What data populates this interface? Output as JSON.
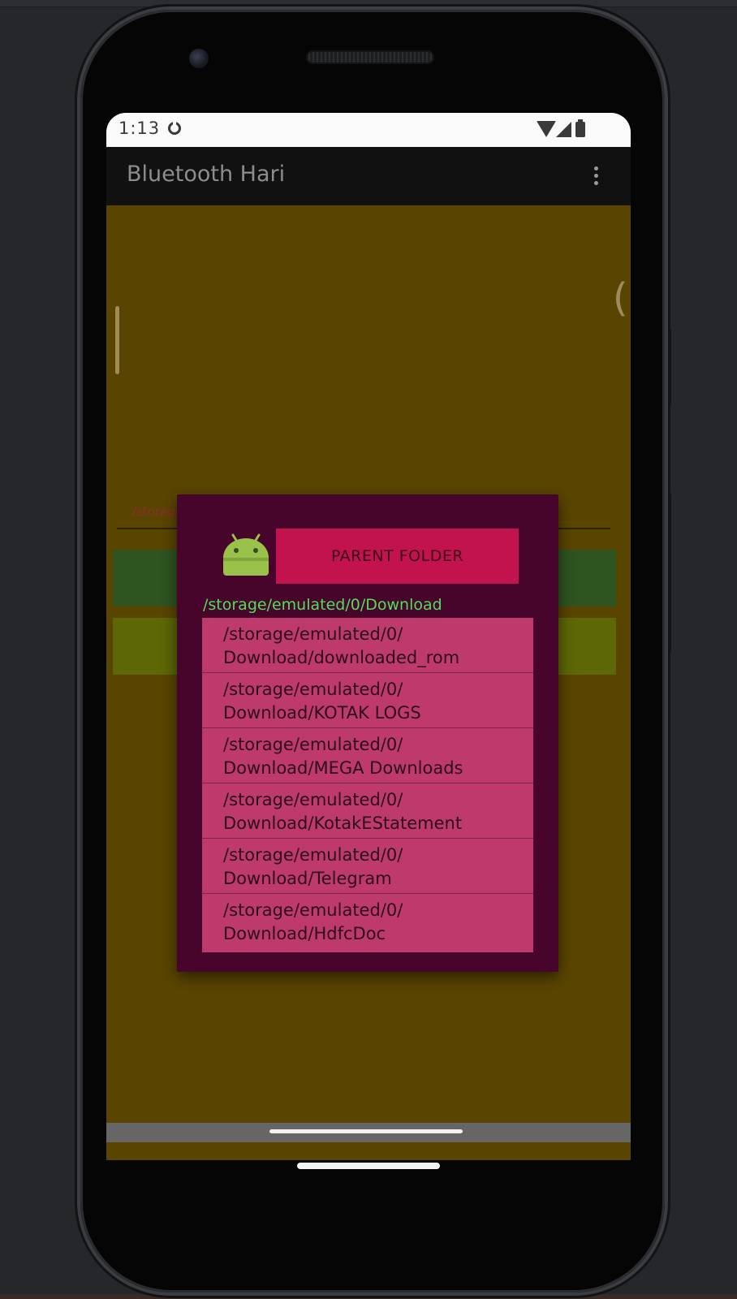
{
  "status_bar": {
    "time": "1:13"
  },
  "app_bar": {
    "title": "Bluetooth Hari"
  },
  "background": {
    "path_field_text": "/storag"
  },
  "dialog": {
    "parent_folder_label": "PARENT FOLDER",
    "current_path": "/storage/emulated/0/Download",
    "folders": [
      "/storage/emulated/0/\nDownload/downloaded_rom",
      "/storage/emulated/0/\nDownload/KOTAK LOGS",
      "/storage/emulated/0/\nDownload/MEGA Downloads",
      "/storage/emulated/0/\nDownload/KotakEStatement",
      "/storage/emulated/0/\nDownload/Telegram",
      "/storage/emulated/0/\nDownload/HdfcDoc"
    ]
  },
  "colors": {
    "screen_background": "#5a4500",
    "dialog_background": "#48052b",
    "parent_button": "#c2134f",
    "list_background": "#be3a6d",
    "path_text": "#4ddf5a"
  },
  "icons": {
    "status": [
      "sync-icon",
      "wifi-icon",
      "signal-icon",
      "battery-icon"
    ],
    "app_bar": "overflow-menu-icon",
    "dialog": "android-robot-icon"
  }
}
